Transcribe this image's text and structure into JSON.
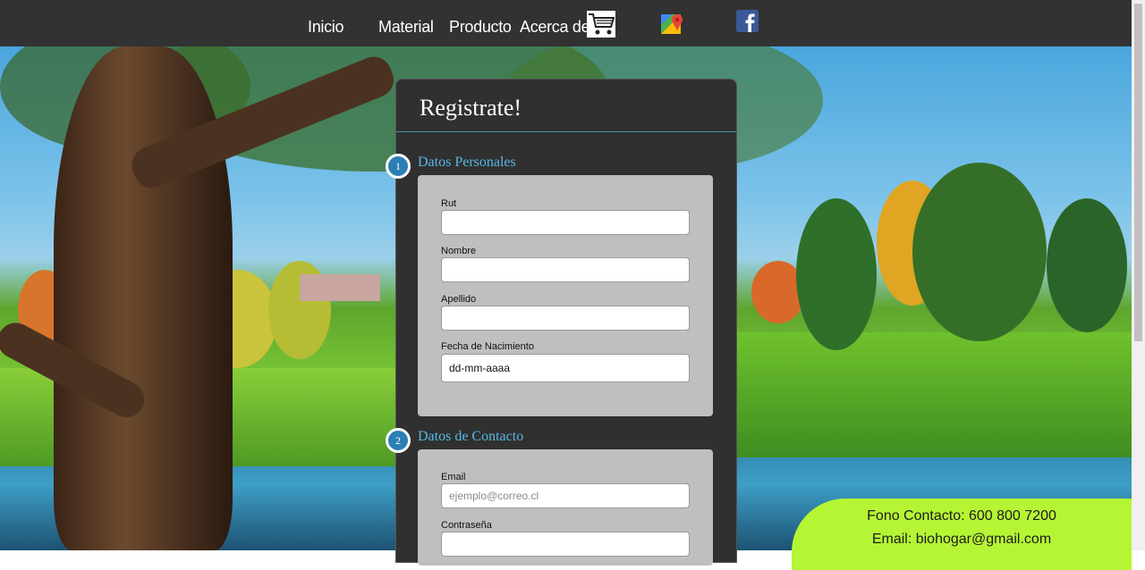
{
  "nav": {
    "links": [
      "Inicio",
      "Material",
      "Producto",
      "Acerca de"
    ],
    "icons": [
      "shopping-cart-icon",
      "google-maps-icon",
      "facebook-icon"
    ]
  },
  "form": {
    "title": "Registrate!",
    "sections": [
      {
        "number": "1",
        "title": "Datos Personales",
        "fields": [
          {
            "label": "Rut",
            "value": "",
            "placeholder": ""
          },
          {
            "label": "Nombre",
            "value": "",
            "placeholder": ""
          },
          {
            "label": "Apellido",
            "value": "",
            "placeholder": ""
          },
          {
            "label": "Fecha de Nacimiento",
            "value": "dd-mm-aaaa",
            "placeholder": ""
          }
        ]
      },
      {
        "number": "2",
        "title": "Datos de Contacto",
        "fields": [
          {
            "label": "Email",
            "value": "",
            "placeholder": "ejemplo@correo.cl"
          },
          {
            "label": "Contraseña",
            "value": "",
            "placeholder": ""
          }
        ]
      }
    ]
  },
  "contact": {
    "phone": "Fono Contacto: 600 800 7200",
    "email": "Email: biohogar@gmail.com"
  },
  "colors": {
    "nav_bg": "#323232",
    "panel_bg": "#303030",
    "section_title": "#56b7e6",
    "step_badge": "#2b7fb5",
    "field_box": "#bfbfbf",
    "contact_bg": "#b5f534"
  }
}
